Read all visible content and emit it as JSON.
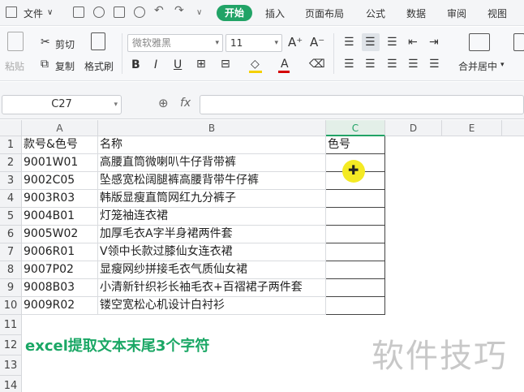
{
  "menu": {
    "file_label": "文件",
    "tabs": [
      "开始",
      "插入",
      "页面布局",
      "公式",
      "数据",
      "审阅",
      "视图"
    ]
  },
  "ribbon": {
    "paste_label": "粘贴",
    "cut_label": "剪切",
    "copy_label": "复制",
    "format_painter_label": "格式刷",
    "font_name": "微软雅黑",
    "font_size": "11",
    "merge_label": "合并居中",
    "font_color": "#d40000",
    "fill_color": "#f4d000"
  },
  "formula_bar": {
    "cell_ref": "C27",
    "fx_label": "fx"
  },
  "sheet": {
    "columns": [
      "A",
      "B",
      "C",
      "D",
      "E"
    ],
    "selected_column": "C",
    "rows": [
      {
        "num": "1",
        "a": "款号&色号",
        "b": "名称",
        "c": "色号"
      },
      {
        "num": "2",
        "a": "9001W01",
        "b": "高腰直筒微喇叭牛仔背带裤",
        "c": ""
      },
      {
        "num": "3",
        "a": "9002C05",
        "b": "坠感宽松阔腿裤高腰背带牛仔裤",
        "c": ""
      },
      {
        "num": "4",
        "a": "9003R03",
        "b": "韩版显瘦直筒网红九分裤子",
        "c": ""
      },
      {
        "num": "5",
        "a": "9004B01",
        "b": "灯笼袖连衣裙",
        "c": ""
      },
      {
        "num": "6",
        "a": "9005W02",
        "b": "加厚毛衣A字半身裙两件套",
        "c": ""
      },
      {
        "num": "7",
        "a": "9006R01",
        "b": "V领中长款过膝仙女连衣裙",
        "c": ""
      },
      {
        "num": "8",
        "a": "9007P02",
        "b": "显瘦网纱拼接毛衣气质仙女裙",
        "c": ""
      },
      {
        "num": "9",
        "a": "9008B03",
        "b": "小清新针织衫长袖毛衣+百褶裙子两件套",
        "c": ""
      },
      {
        "num": "10",
        "a": "9009R02",
        "b": "镂空宽松心机设计白衬衫",
        "c": ""
      }
    ],
    "empty_rows": [
      "11",
      "12",
      "13",
      "14"
    ],
    "note": "excel提取文本末尾3个字符",
    "watermark": "软件技巧"
  }
}
